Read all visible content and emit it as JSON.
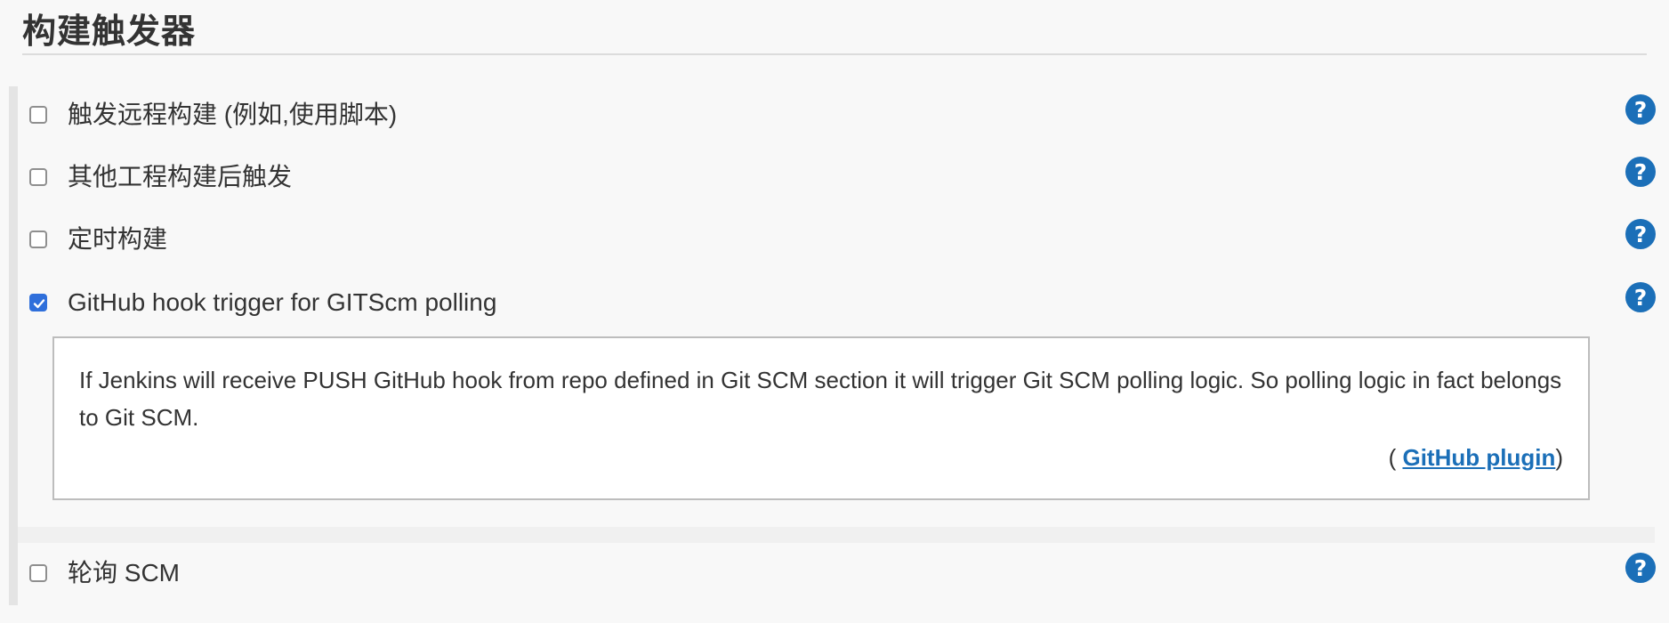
{
  "section": {
    "title": "构建触发器"
  },
  "triggers": [
    {
      "label": "触发远程构建 (例如,使用脚本)",
      "checked": false,
      "help_icon": "question-circle-icon"
    },
    {
      "label": "其他工程构建后触发",
      "checked": false,
      "help_icon": "question-circle-icon"
    },
    {
      "label": "定时构建",
      "checked": false,
      "help_icon": "question-circle-icon"
    },
    {
      "label": "GitHub hook trigger for GITScm polling",
      "checked": true,
      "help_icon": "question-circle-icon"
    },
    {
      "label": "轮询 SCM",
      "checked": false,
      "help_icon": "question-circle-icon"
    }
  ],
  "help_panel": {
    "text": "If Jenkins will receive PUSH GitHub hook from repo defined in Git SCM section it will trigger Git SCM polling logic. So polling logic in fact belongs to Git SCM.",
    "plugin_prefix": "( ",
    "plugin_link": "GitHub plugin",
    "plugin_suffix": ")"
  },
  "colors": {
    "accent": "#2f6fdb",
    "help_icon": "#1b6fb8",
    "link": "#1b6fb8",
    "background": "#f8f8f8"
  }
}
